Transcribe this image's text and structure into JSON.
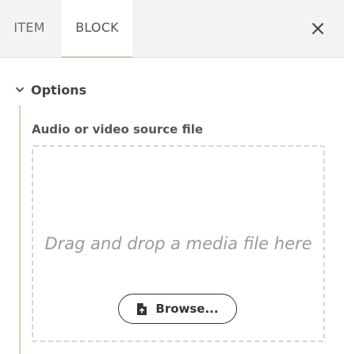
{
  "tabs": [
    {
      "label": "ITEM",
      "active": false
    },
    {
      "label": "BLOCK",
      "active": true
    }
  ],
  "close": {
    "icon": "close-icon"
  },
  "options": {
    "label": "Options",
    "expanded": true,
    "chevron_icon": "chevron-down-icon"
  },
  "field": {
    "label": "Audio or video source file"
  },
  "dropzone": {
    "text": "Drag and drop a media file here",
    "browse_label": "Browse...",
    "browse_icon": "file-upload-icon"
  },
  "colors": {
    "accent": "#bcd4a1",
    "tabbar_bg": "#f3f3f3",
    "dash": "#d6d6d6"
  }
}
